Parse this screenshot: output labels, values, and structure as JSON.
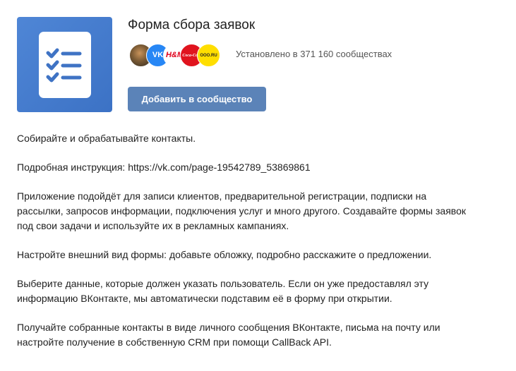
{
  "app": {
    "title": "Форма сбора заявок",
    "installs_text": "Установлено в 371 160 сообществах",
    "add_button_label": "Добавить в сообщество",
    "icon": "checklist-icon",
    "accent_color": "#5b83b8",
    "icon_bg_color": "#4a7fd2"
  },
  "communities": [
    {
      "name": "community-avatar-photo",
      "label": "",
      "bg": "#6b5a3a"
    },
    {
      "name": "vk-logo",
      "label": "VK",
      "bg": "#2787f5"
    },
    {
      "name": "hm-logo",
      "label": "H&M",
      "bg": "#ffffff"
    },
    {
      "name": "coca-cola-logo",
      "label": "Coca-Cola",
      "bg": "#e0141e"
    },
    {
      "name": "ooo-ru-logo",
      "label": "OOO.RU",
      "bg": "#ffde00"
    }
  ],
  "description": {
    "p1": [
      "Собирайте и обрабатывайте контакты."
    ],
    "p2": [
      "Подробная инструкция: https://vk.com/page-19542789_53869861"
    ],
    "p3": [
      "Приложение подойдёт для записи клиентов, предварительной регистрации, подписки на",
      "рассылки, запросов информации, подключения услуг и много другого. Создавайте формы заявок",
      "под свои задачи и используйте их в рекламных кампаниях."
    ],
    "p4": [
      "Настройте внешний вид формы: добавьте обложку, подробно расскажите о предложении."
    ],
    "p5": [
      "Выберите данные, которые должен указать пользователь. Если он уже предоставлял эту",
      "информацию ВКонтакте, мы автоматически подставим её в форму при открытии."
    ],
    "p6": [
      "Получайте собранные контакты в виде личного сообщения ВКонтакте, письма на почту или",
      "настройте получение в собственную CRM при помощи CallBack API."
    ]
  }
}
